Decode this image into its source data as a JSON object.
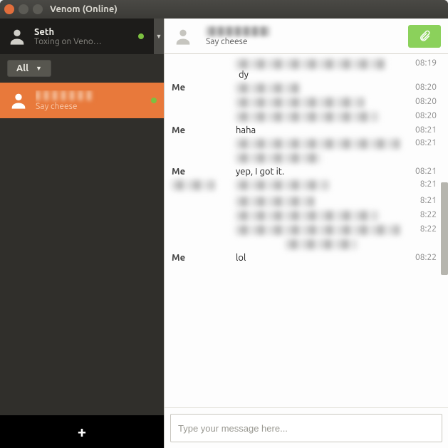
{
  "window": {
    "title": "Venom (Online)"
  },
  "profile": {
    "name": "Seth",
    "status": "Toxing on Veno…"
  },
  "filter": {
    "label": "All"
  },
  "contacts": [
    {
      "status_text": "Say cheese",
      "online": true
    }
  ],
  "chat_header": {
    "substatus": "Say cheese"
  },
  "messages": [
    {
      "sender": "",
      "time": "08:19",
      "blurred": true,
      "tail": "dy",
      "widths": [
        210
      ]
    },
    {
      "sender": "Me",
      "time": "08:20",
      "blurred": true,
      "widths": [
        90
      ]
    },
    {
      "sender": "",
      "time": "08:20",
      "blurred": true,
      "widths": [
        180
      ]
    },
    {
      "sender": "",
      "time": "08:20",
      "blurred": true,
      "widths": [
        200
      ]
    },
    {
      "sender": "Me",
      "time": "08:21",
      "text": "haha"
    },
    {
      "sender": "",
      "time": "08:21",
      "blurred": true,
      "widths": [
        230
      ]
    },
    {
      "sender": "",
      "time": "",
      "blurred": true,
      "widths": [
        120
      ]
    },
    {
      "sender": "Me",
      "time": "08:21",
      "text": "yep, I got it."
    },
    {
      "sender": "",
      "time": "8:21",
      "blurred": true,
      "widths": [
        130
      ],
      "blur_sender": true
    },
    {
      "sender": "",
      "time": "8:21",
      "blurred": true,
      "widths": [
        110
      ]
    },
    {
      "sender": "",
      "time": "8:22",
      "blurred": true,
      "widths": [
        200
      ]
    },
    {
      "sender": "",
      "time": "8:22",
      "blurred": true,
      "widths": [
        230
      ]
    },
    {
      "sender": "",
      "time": "",
      "blurred": true,
      "widths": [
        100
      ],
      "indent": true
    },
    {
      "sender": "Me",
      "time": "08:22",
      "text": "lol"
    }
  ],
  "composer": {
    "placeholder": "Type your message here..."
  },
  "add_button": {
    "label": "+"
  }
}
